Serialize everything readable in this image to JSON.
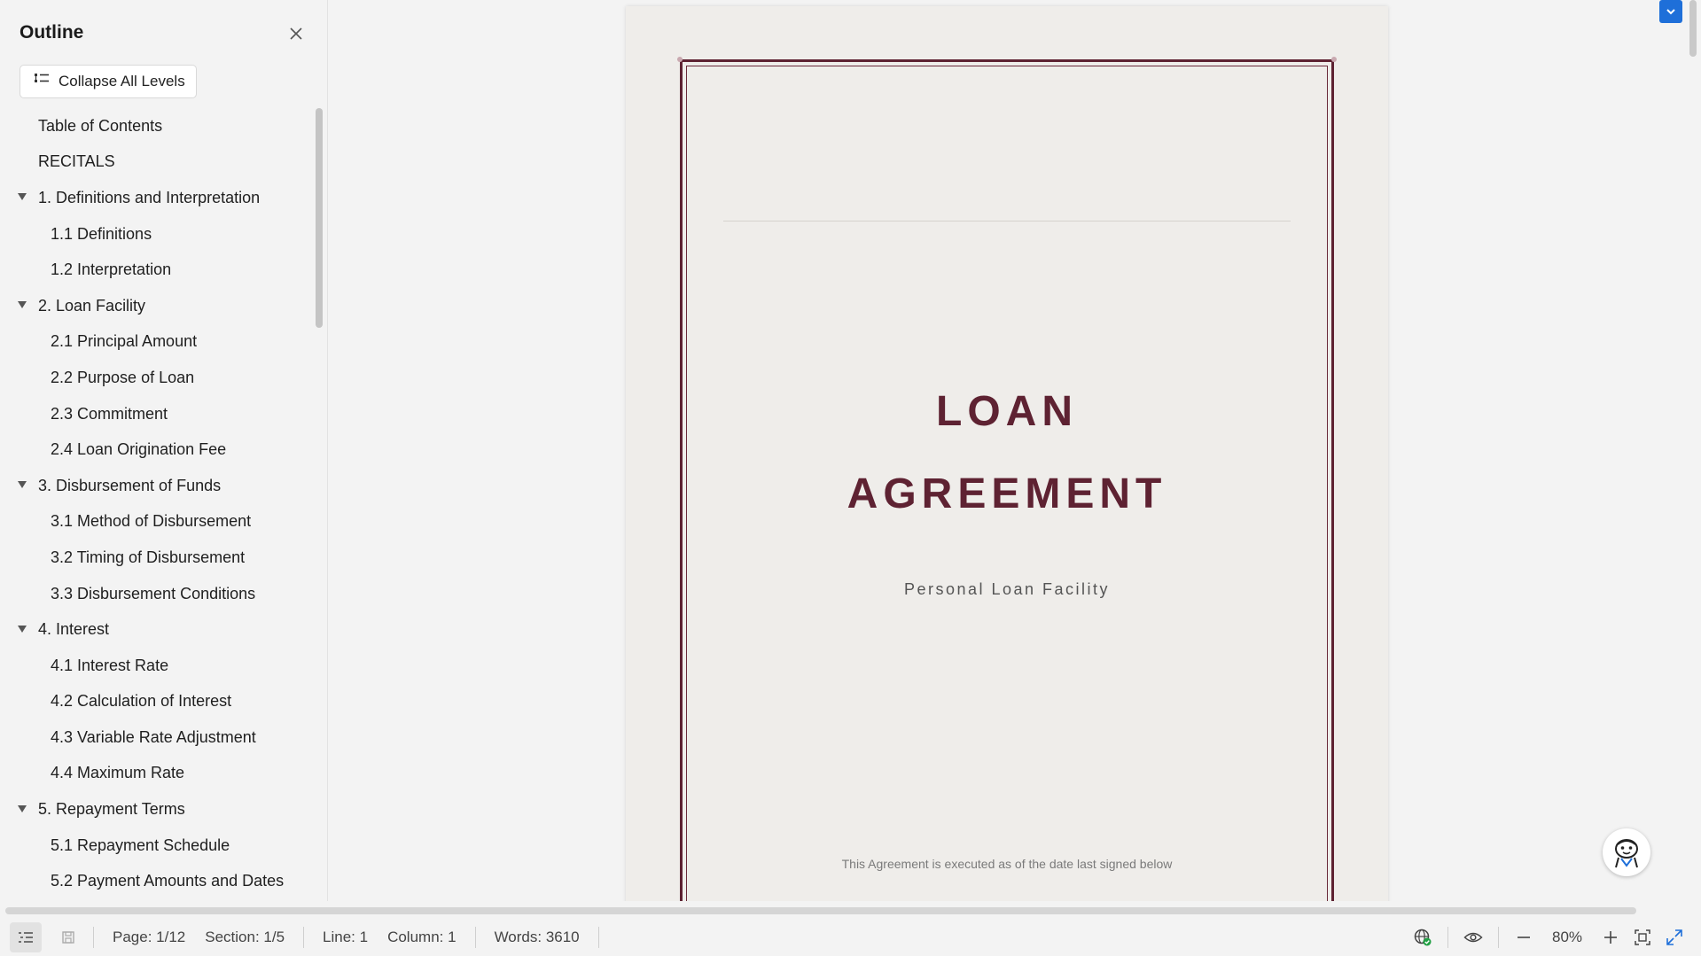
{
  "sidebar": {
    "title": "Outline",
    "collapse_label": "Collapse All Levels",
    "items": [
      {
        "label": "Table of Contents",
        "level": 1,
        "expandable": false
      },
      {
        "label": "RECITALS",
        "level": 1,
        "expandable": false
      },
      {
        "label": "1. Definitions and Interpretation",
        "level": 1,
        "expandable": true
      },
      {
        "label": "1.1 Definitions",
        "level": 2,
        "expandable": false
      },
      {
        "label": "1.2 Interpretation",
        "level": 2,
        "expandable": false
      },
      {
        "label": "2. Loan Facility",
        "level": 1,
        "expandable": true
      },
      {
        "label": "2.1 Principal Amount",
        "level": 2,
        "expandable": false
      },
      {
        "label": "2.2 Purpose of Loan",
        "level": 2,
        "expandable": false
      },
      {
        "label": "2.3 Commitment",
        "level": 2,
        "expandable": false
      },
      {
        "label": "2.4 Loan Origination Fee",
        "level": 2,
        "expandable": false
      },
      {
        "label": "3. Disbursement of Funds",
        "level": 1,
        "expandable": true
      },
      {
        "label": "3.1 Method of Disbursement",
        "level": 2,
        "expandable": false
      },
      {
        "label": "3.2 Timing of Disbursement",
        "level": 2,
        "expandable": false
      },
      {
        "label": "3.3 Disbursement Conditions",
        "level": 2,
        "expandable": false
      },
      {
        "label": "4. Interest",
        "level": 1,
        "expandable": true
      },
      {
        "label": "4.1 Interest Rate",
        "level": 2,
        "expandable": false
      },
      {
        "label": "4.2 Calculation of Interest",
        "level": 2,
        "expandable": false
      },
      {
        "label": "4.3 Variable Rate Adjustment",
        "level": 2,
        "expandable": false
      },
      {
        "label": "4.4 Maximum Rate",
        "level": 2,
        "expandable": false
      },
      {
        "label": "5. Repayment Terms",
        "level": 1,
        "expandable": true
      },
      {
        "label": "5.1 Repayment Schedule",
        "level": 2,
        "expandable": false
      },
      {
        "label": "5.2 Payment Amounts and Dates",
        "level": 2,
        "expandable": false
      }
    ]
  },
  "document": {
    "title_line1": "LOAN",
    "title_line2": "AGREEMENT",
    "subtitle": "Personal Loan Facility",
    "executed_note": "This Agreement is executed as of the date last signed below",
    "accent_color": "#5e2232"
  },
  "statusbar": {
    "page": "Page: 1/12",
    "section": "Section: 1/5",
    "line": "Line: 1",
    "column": "Column: 1",
    "words": "Words: 3610",
    "zoom": "80%"
  },
  "icons": {
    "close": "close-icon",
    "collapse": "collapse-levels-icon",
    "outline_toggle": "outline-panel-icon",
    "save": "save-icon",
    "web": "globe-check-icon",
    "read_mode": "eye-icon",
    "zoom_out": "minus-icon",
    "zoom_in": "plus-icon",
    "fit": "fit-page-icon",
    "fullscreen": "fullscreen-icon",
    "assistant": "assistant-mascot-icon",
    "dropdown": "chevron-down-icon"
  }
}
